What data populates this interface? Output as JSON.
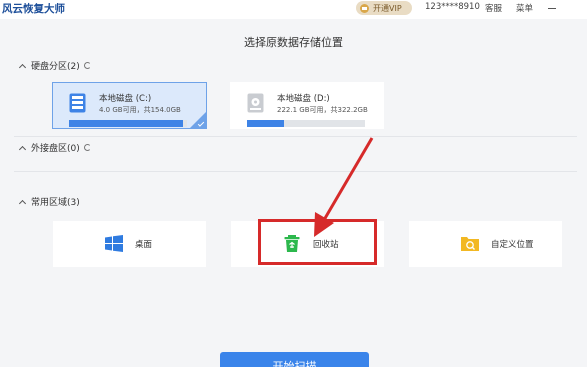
{
  "titlebar": {
    "app_title": "风云恢复大师",
    "vip_label": "开通VIP",
    "user_id": "123****8910",
    "service_label": "客服",
    "menu_label": "菜单"
  },
  "page": {
    "title": "选择原数据存储位置"
  },
  "sections": {
    "disks": {
      "label": "硬盘分区(2)"
    },
    "external": {
      "label": "外接盘区(0)"
    },
    "common": {
      "label": "常用区域(3)"
    }
  },
  "disks": [
    {
      "name": "本地磁盘 (C:)",
      "size_text": "4.0 GB可用，共154.0GB",
      "used_fraction": 0.97,
      "selected": true
    },
    {
      "name": "本地磁盘 (D:)",
      "size_text": "222.1 GB可用，共322.2GB",
      "used_fraction": 0.31,
      "selected": false
    }
  ],
  "locations": [
    {
      "label": "桌面",
      "icon": "windows-icon"
    },
    {
      "label": "回收站",
      "icon": "recycle-bin-icon"
    },
    {
      "label": "自定义位置",
      "icon": "folder-search-icon"
    }
  ],
  "actions": {
    "start_scan": "开始扫描"
  },
  "colors": {
    "accent": "#3a84ea",
    "highlight": "#d62a2a",
    "selected_bg": "#dce9fb"
  }
}
